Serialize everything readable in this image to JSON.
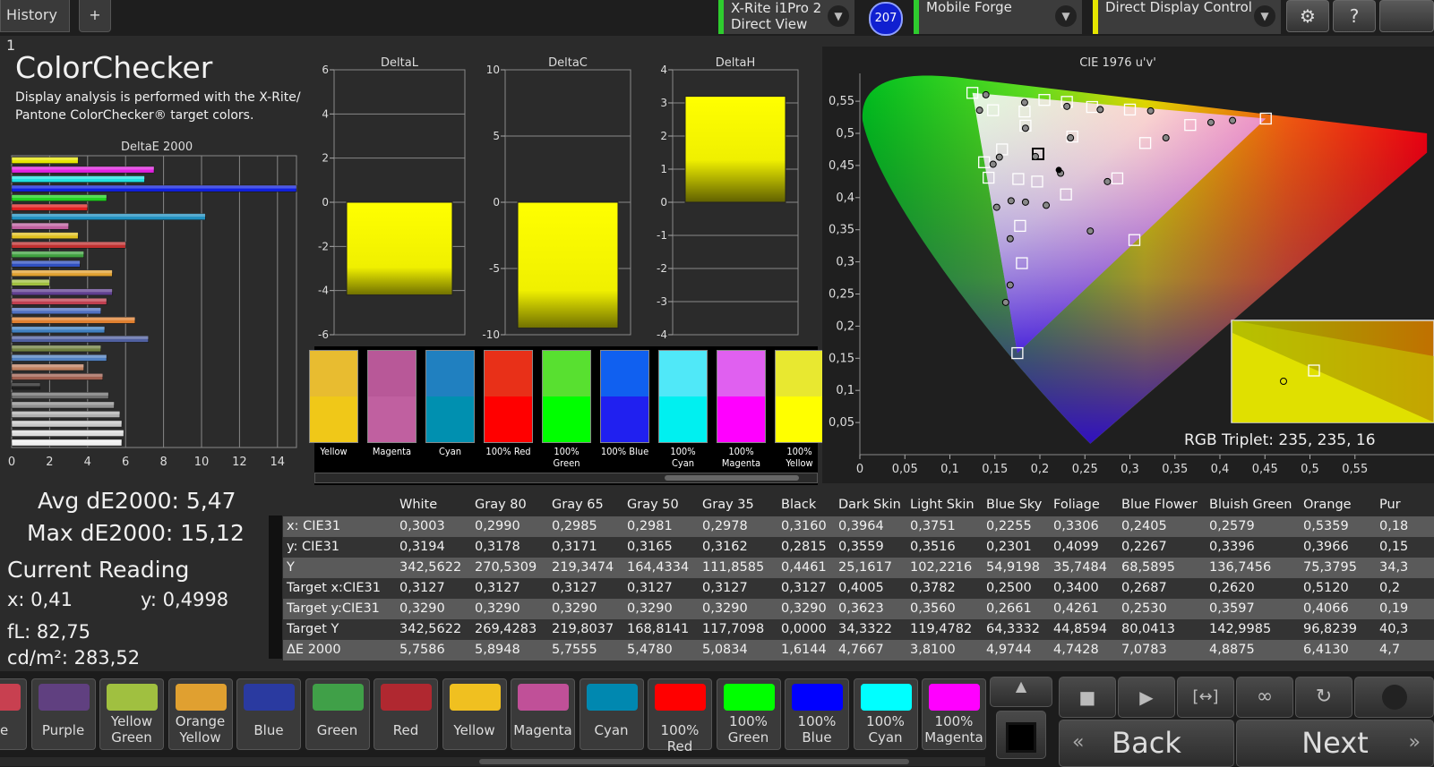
{
  "topbar": {
    "tab_label": "History 1",
    "add_tab": "+",
    "meter": {
      "line1": "X-Rite i1Pro 2",
      "line2": "Direct View"
    },
    "badge": "207",
    "profile": "Mobile Forge",
    "control": "Direct Display Control",
    "settings_icon": "gear-icon",
    "help_label": "?"
  },
  "header": {
    "title": "ColorChecker",
    "desc1": "Display analysis is performed with the X-Rite/",
    "desc2": "Pantone ColorChecker® target colors."
  },
  "deltae_chart": {
    "title": "DeltaE 2000",
    "ticks": [
      "0",
      "2",
      "4",
      "6",
      "8",
      "10",
      "12",
      "14"
    ],
    "xlim": [
      0,
      15
    ],
    "values": [
      3.5,
      7.5,
      7,
      15.5,
      5,
      4,
      10.2,
      3,
      3.5,
      6,
      3.8,
      3.6,
      5.3,
      2,
      5.3,
      5,
      4.7,
      6.5,
      4.9,
      7.2,
      4.7,
      5,
      3.8,
      4.8,
      1.5,
      5.1,
      5.4,
      5.7,
      5.8,
      5.9,
      5.8
    ],
    "colors": [
      "#e6e600",
      "#e020e0",
      "#20e0e0",
      "#1020e0",
      "#20d020",
      "#e02020",
      "#2090c0",
      "#c060a0",
      "#e0c020",
      "#c03030",
      "#40a040",
      "#3050c0",
      "#e0a030",
      "#a0c040",
      "#604090",
      "#c04050",
      "#5070c0",
      "#e08030",
      "#4080c0",
      "#5060a0",
      "#708040",
      "#5080c0",
      "#c08060",
      "#a06050",
      "#202020",
      "#707070",
      "#909090",
      "#b0b0b0",
      "#c8c8c8",
      "#dcdcdc",
      "#f0f0f0"
    ]
  },
  "small_charts": [
    {
      "title": "DeltaL",
      "ticks": [
        "6",
        "4",
        "2",
        "0",
        "-2",
        "-4",
        "-6"
      ],
      "ylim": [
        -6,
        6
      ],
      "value": -4.2
    },
    {
      "title": "DeltaC",
      "ticks": [
        "10",
        "5",
        "0",
        "-5",
        "-10"
      ],
      "ylim": [
        -10,
        10
      ],
      "value": -9.5
    },
    {
      "title": "DeltaH",
      "ticks": [
        "4",
        "3",
        "2",
        "1",
        "0",
        "-1",
        "-2",
        "-3",
        "-4"
      ],
      "ylim": [
        -4,
        4
      ],
      "value": 3.2
    }
  ],
  "patches": [
    {
      "label": "Yellow",
      "top": "#e8bc30",
      "bottom": "#f0c818"
    },
    {
      "label": "Magenta",
      "top": "#b85898",
      "bottom": "#c060a0"
    },
    {
      "label": "Cyan",
      "top": "#2080c0",
      "bottom": "#0090b0"
    },
    {
      "label": "100% Red",
      "top": "#e83018",
      "bottom": "#ff0000"
    },
    {
      "label": "100% Green",
      "top": "#58e030",
      "bottom": "#00ff00"
    },
    {
      "label": "100% Blue",
      "top": "#1060f0",
      "bottom": "#2020f0"
    },
    {
      "label": "100% Cyan",
      "top": "#50e8f8",
      "bottom": "#00f0f0"
    },
    {
      "label": "100% Magenta",
      "top": "#e060f0",
      "bottom": "#ff00ff"
    },
    {
      "label": "100% Yellow",
      "top": "#e8e830",
      "bottom": "#ffff00"
    }
  ],
  "cie": {
    "title": "CIE 1976 u'v'",
    "xticks": [
      "0",
      "0,05",
      "0,1",
      "0,15",
      "0,2",
      "0,25",
      "0,3",
      "0,35",
      "0,4",
      "0,45",
      "0,5",
      "0,55"
    ],
    "yticks": [
      "0,55",
      "0,5",
      "0,45",
      "0,4",
      "0,35",
      "0,3",
      "0,25",
      "0,2",
      "0,15",
      "0,1",
      "0,05"
    ],
    "rgb_triplet": "RGB Triplet: 235, 235, 16"
  },
  "stats": {
    "avg": "Avg dE2000: 5,47",
    "max": "Max dE2000: 15,12",
    "current_title": "Current Reading",
    "x": "x: 0,41",
    "y": "y: 0,4998",
    "fl": "fL: 82,75",
    "cdm": "cd/m²: 283,52"
  },
  "table": {
    "columns": [
      "White",
      "Gray 80",
      "Gray 65",
      "Gray 50",
      "Gray 35",
      "Black",
      "Dark Skin",
      "Light Skin",
      "Blue Sky",
      "Foliage",
      "Blue Flower",
      "Bluish Green",
      "Orange",
      "Pur"
    ],
    "rows": [
      {
        "label": "x: CIE31",
        "cells": [
          "0,3003",
          "0,2990",
          "0,2985",
          "0,2981",
          "0,2978",
          "0,3160",
          "0,3964",
          "0,3751",
          "0,2255",
          "0,3306",
          "0,2405",
          "0,2579",
          "0,5359",
          "0,18"
        ]
      },
      {
        "label": "y: CIE31",
        "cells": [
          "0,3194",
          "0,3178",
          "0,3171",
          "0,3165",
          "0,3162",
          "0,2815",
          "0,3559",
          "0,3516",
          "0,2301",
          "0,4099",
          "0,2267",
          "0,3396",
          "0,3966",
          "0,15"
        ]
      },
      {
        "label": "Y",
        "cells": [
          "342,5622",
          "270,5309",
          "219,3474",
          "164,4334",
          "111,8585",
          "0,4461",
          "25,1617",
          "102,2216",
          "54,9198",
          "35,7484",
          "68,5895",
          "136,7456",
          "75,3795",
          "34,3"
        ]
      },
      {
        "label": "Target x:CIE31",
        "cells": [
          "0,3127",
          "0,3127",
          "0,3127",
          "0,3127",
          "0,3127",
          "0,3127",
          "0,4005",
          "0,3782",
          "0,2500",
          "0,3400",
          "0,2687",
          "0,2620",
          "0,5120",
          "0,2"
        ]
      },
      {
        "label": "Target y:CIE31",
        "cells": [
          "0,3290",
          "0,3290",
          "0,3290",
          "0,3290",
          "0,3290",
          "0,3290",
          "0,3623",
          "0,3560",
          "0,2661",
          "0,4261",
          "0,2530",
          "0,3597",
          "0,4066",
          "0,19"
        ]
      },
      {
        "label": "Target Y",
        "cells": [
          "342,5622",
          "269,4283",
          "219,8037",
          "168,8141",
          "117,7098",
          "0,0000",
          "34,3322",
          "119,4782",
          "64,3332",
          "44,8594",
          "80,0413",
          "142,9985",
          "96,8239",
          "40,3"
        ]
      },
      {
        "label": "ΔE 2000",
        "cells": [
          "5,7586",
          "5,8948",
          "5,7555",
          "5,4780",
          "5,0834",
          "1,6144",
          "4,7667",
          "3,8100",
          "4,9744",
          "4,7428",
          "7,0783",
          "4,8875",
          "6,4130",
          "4,7"
        ]
      }
    ]
  },
  "swatches": [
    {
      "label": "rate",
      "color": "#c84050"
    },
    {
      "label": "Purple",
      "color": "#604080"
    },
    {
      "label": "Yellow Green",
      "color": "#a0c040"
    },
    {
      "label": "Orange Yellow",
      "color": "#e0a030"
    },
    {
      "label": "Blue",
      "color": "#2a3aa0"
    },
    {
      "label": "Green",
      "color": "#40a048"
    },
    {
      "label": "Red",
      "color": "#b02830"
    },
    {
      "label": "Yellow",
      "color": "#f0c020"
    },
    {
      "label": "Magenta",
      "color": "#c05098"
    },
    {
      "label": "Cyan",
      "color": "#0088b0"
    },
    {
      "label": "100% Red",
      "color": "#ff0000"
    },
    {
      "label": "100% Green",
      "color": "#00ff00"
    },
    {
      "label": "100% Blue",
      "color": "#0000ff"
    },
    {
      "label": "100% Cyan",
      "color": "#00ffff"
    },
    {
      "label": "100% Magenta",
      "color": "#ff00ff"
    }
  ],
  "nav": {
    "back": "Back",
    "next": "Next"
  }
}
